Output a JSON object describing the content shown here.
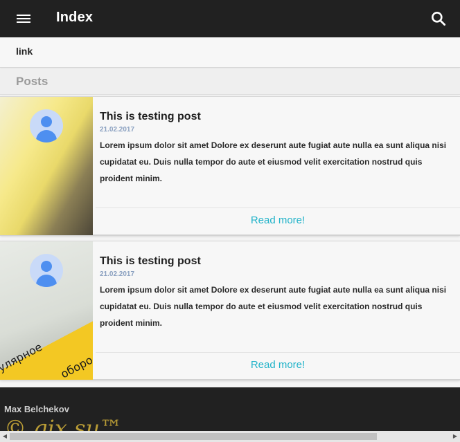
{
  "appbar": {
    "title": "Index",
    "menu_icon": "menu-icon",
    "search_icon": "search-icon"
  },
  "nav": {
    "link_label": "link"
  },
  "section": {
    "title": "Posts"
  },
  "posts": [
    {
      "title": "This is testing post",
      "date": "21.02.2017",
      "text": "Lorem ipsum dolor sit amet Dolore ex deserunt aute fugiat aute nulla ea sunt aliqua nisi cupidatat eu. Duis nulla tempor do aute et eiusmod velit exercitation nostrud quis proident minim.",
      "read_more": "Read more!",
      "thumb_words": []
    },
    {
      "title": "This is testing post",
      "date": "21.02.2017",
      "text": "Lorem ipsum dolor sit amet Dolore ex deserunt aute fugiat aute nulla ea sunt aliqua nisi cupidatat eu. Duis nulla tempor do aute et eiusmod velit exercitation nostrud quis proident minim.",
      "read_more": "Read more!",
      "thumb_words": [
        "улярное",
        "оборо"
      ]
    }
  ],
  "footer": {
    "name": "Max Belchekov",
    "watermark": "© gix.su™"
  },
  "colors": {
    "appbar": "#212121",
    "accent": "#22b3c9",
    "date": "#8aa0c0",
    "avatar": "#4e8ff0"
  }
}
